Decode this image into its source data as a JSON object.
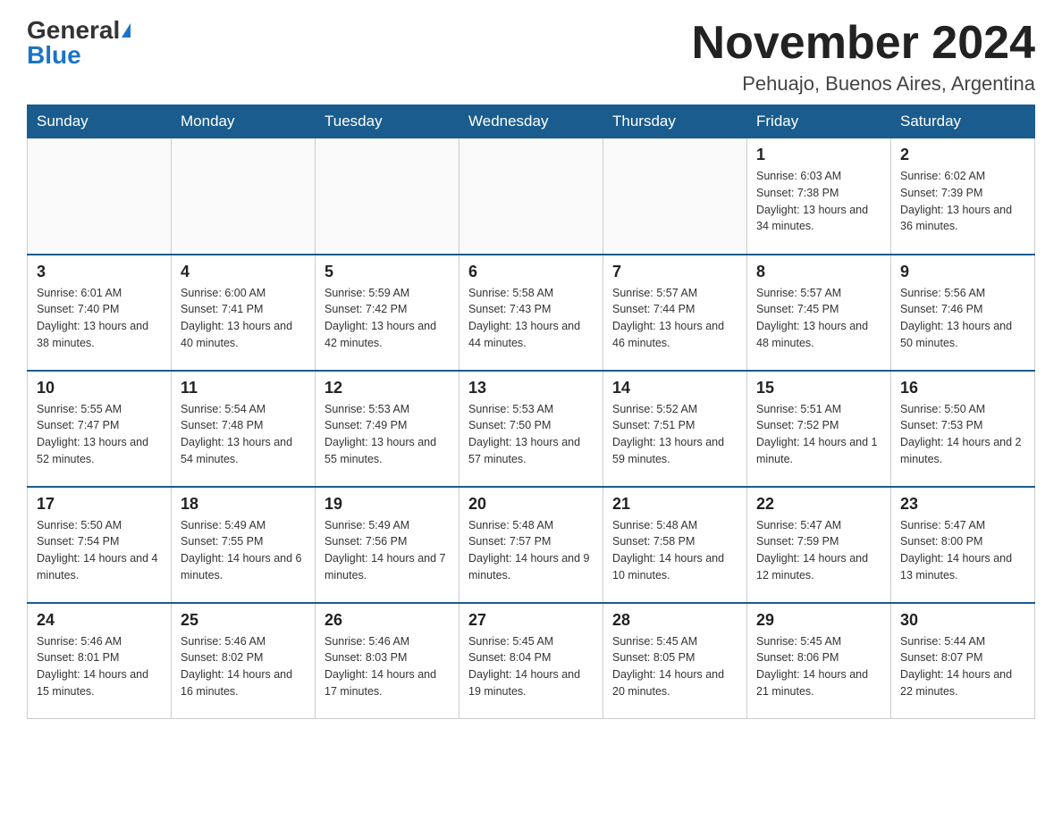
{
  "header": {
    "logo_general": "General",
    "logo_blue": "Blue",
    "month_title": "November 2024",
    "location": "Pehuajo, Buenos Aires, Argentina"
  },
  "weekdays": [
    "Sunday",
    "Monday",
    "Tuesday",
    "Wednesday",
    "Thursday",
    "Friday",
    "Saturday"
  ],
  "weeks": [
    [
      {
        "day": "",
        "sunrise": "",
        "sunset": "",
        "daylight": ""
      },
      {
        "day": "",
        "sunrise": "",
        "sunset": "",
        "daylight": ""
      },
      {
        "day": "",
        "sunrise": "",
        "sunset": "",
        "daylight": ""
      },
      {
        "day": "",
        "sunrise": "",
        "sunset": "",
        "daylight": ""
      },
      {
        "day": "",
        "sunrise": "",
        "sunset": "",
        "daylight": ""
      },
      {
        "day": "1",
        "sunrise": "Sunrise: 6:03 AM",
        "sunset": "Sunset: 7:38 PM",
        "daylight": "Daylight: 13 hours and 34 minutes."
      },
      {
        "day": "2",
        "sunrise": "Sunrise: 6:02 AM",
        "sunset": "Sunset: 7:39 PM",
        "daylight": "Daylight: 13 hours and 36 minutes."
      }
    ],
    [
      {
        "day": "3",
        "sunrise": "Sunrise: 6:01 AM",
        "sunset": "Sunset: 7:40 PM",
        "daylight": "Daylight: 13 hours and 38 minutes."
      },
      {
        "day": "4",
        "sunrise": "Sunrise: 6:00 AM",
        "sunset": "Sunset: 7:41 PM",
        "daylight": "Daylight: 13 hours and 40 minutes."
      },
      {
        "day": "5",
        "sunrise": "Sunrise: 5:59 AM",
        "sunset": "Sunset: 7:42 PM",
        "daylight": "Daylight: 13 hours and 42 minutes."
      },
      {
        "day": "6",
        "sunrise": "Sunrise: 5:58 AM",
        "sunset": "Sunset: 7:43 PM",
        "daylight": "Daylight: 13 hours and 44 minutes."
      },
      {
        "day": "7",
        "sunrise": "Sunrise: 5:57 AM",
        "sunset": "Sunset: 7:44 PM",
        "daylight": "Daylight: 13 hours and 46 minutes."
      },
      {
        "day": "8",
        "sunrise": "Sunrise: 5:57 AM",
        "sunset": "Sunset: 7:45 PM",
        "daylight": "Daylight: 13 hours and 48 minutes."
      },
      {
        "day": "9",
        "sunrise": "Sunrise: 5:56 AM",
        "sunset": "Sunset: 7:46 PM",
        "daylight": "Daylight: 13 hours and 50 minutes."
      }
    ],
    [
      {
        "day": "10",
        "sunrise": "Sunrise: 5:55 AM",
        "sunset": "Sunset: 7:47 PM",
        "daylight": "Daylight: 13 hours and 52 minutes."
      },
      {
        "day": "11",
        "sunrise": "Sunrise: 5:54 AM",
        "sunset": "Sunset: 7:48 PM",
        "daylight": "Daylight: 13 hours and 54 minutes."
      },
      {
        "day": "12",
        "sunrise": "Sunrise: 5:53 AM",
        "sunset": "Sunset: 7:49 PM",
        "daylight": "Daylight: 13 hours and 55 minutes."
      },
      {
        "day": "13",
        "sunrise": "Sunrise: 5:53 AM",
        "sunset": "Sunset: 7:50 PM",
        "daylight": "Daylight: 13 hours and 57 minutes."
      },
      {
        "day": "14",
        "sunrise": "Sunrise: 5:52 AM",
        "sunset": "Sunset: 7:51 PM",
        "daylight": "Daylight: 13 hours and 59 minutes."
      },
      {
        "day": "15",
        "sunrise": "Sunrise: 5:51 AM",
        "sunset": "Sunset: 7:52 PM",
        "daylight": "Daylight: 14 hours and 1 minute."
      },
      {
        "day": "16",
        "sunrise": "Sunrise: 5:50 AM",
        "sunset": "Sunset: 7:53 PM",
        "daylight": "Daylight: 14 hours and 2 minutes."
      }
    ],
    [
      {
        "day": "17",
        "sunrise": "Sunrise: 5:50 AM",
        "sunset": "Sunset: 7:54 PM",
        "daylight": "Daylight: 14 hours and 4 minutes."
      },
      {
        "day": "18",
        "sunrise": "Sunrise: 5:49 AM",
        "sunset": "Sunset: 7:55 PM",
        "daylight": "Daylight: 14 hours and 6 minutes."
      },
      {
        "day": "19",
        "sunrise": "Sunrise: 5:49 AM",
        "sunset": "Sunset: 7:56 PM",
        "daylight": "Daylight: 14 hours and 7 minutes."
      },
      {
        "day": "20",
        "sunrise": "Sunrise: 5:48 AM",
        "sunset": "Sunset: 7:57 PM",
        "daylight": "Daylight: 14 hours and 9 minutes."
      },
      {
        "day": "21",
        "sunrise": "Sunrise: 5:48 AM",
        "sunset": "Sunset: 7:58 PM",
        "daylight": "Daylight: 14 hours and 10 minutes."
      },
      {
        "day": "22",
        "sunrise": "Sunrise: 5:47 AM",
        "sunset": "Sunset: 7:59 PM",
        "daylight": "Daylight: 14 hours and 12 minutes."
      },
      {
        "day": "23",
        "sunrise": "Sunrise: 5:47 AM",
        "sunset": "Sunset: 8:00 PM",
        "daylight": "Daylight: 14 hours and 13 minutes."
      }
    ],
    [
      {
        "day": "24",
        "sunrise": "Sunrise: 5:46 AM",
        "sunset": "Sunset: 8:01 PM",
        "daylight": "Daylight: 14 hours and 15 minutes."
      },
      {
        "day": "25",
        "sunrise": "Sunrise: 5:46 AM",
        "sunset": "Sunset: 8:02 PM",
        "daylight": "Daylight: 14 hours and 16 minutes."
      },
      {
        "day": "26",
        "sunrise": "Sunrise: 5:46 AM",
        "sunset": "Sunset: 8:03 PM",
        "daylight": "Daylight: 14 hours and 17 minutes."
      },
      {
        "day": "27",
        "sunrise": "Sunrise: 5:45 AM",
        "sunset": "Sunset: 8:04 PM",
        "daylight": "Daylight: 14 hours and 19 minutes."
      },
      {
        "day": "28",
        "sunrise": "Sunrise: 5:45 AM",
        "sunset": "Sunset: 8:05 PM",
        "daylight": "Daylight: 14 hours and 20 minutes."
      },
      {
        "day": "29",
        "sunrise": "Sunrise: 5:45 AM",
        "sunset": "Sunset: 8:06 PM",
        "daylight": "Daylight: 14 hours and 21 minutes."
      },
      {
        "day": "30",
        "sunrise": "Sunrise: 5:44 AM",
        "sunset": "Sunset: 8:07 PM",
        "daylight": "Daylight: 14 hours and 22 minutes."
      }
    ]
  ]
}
